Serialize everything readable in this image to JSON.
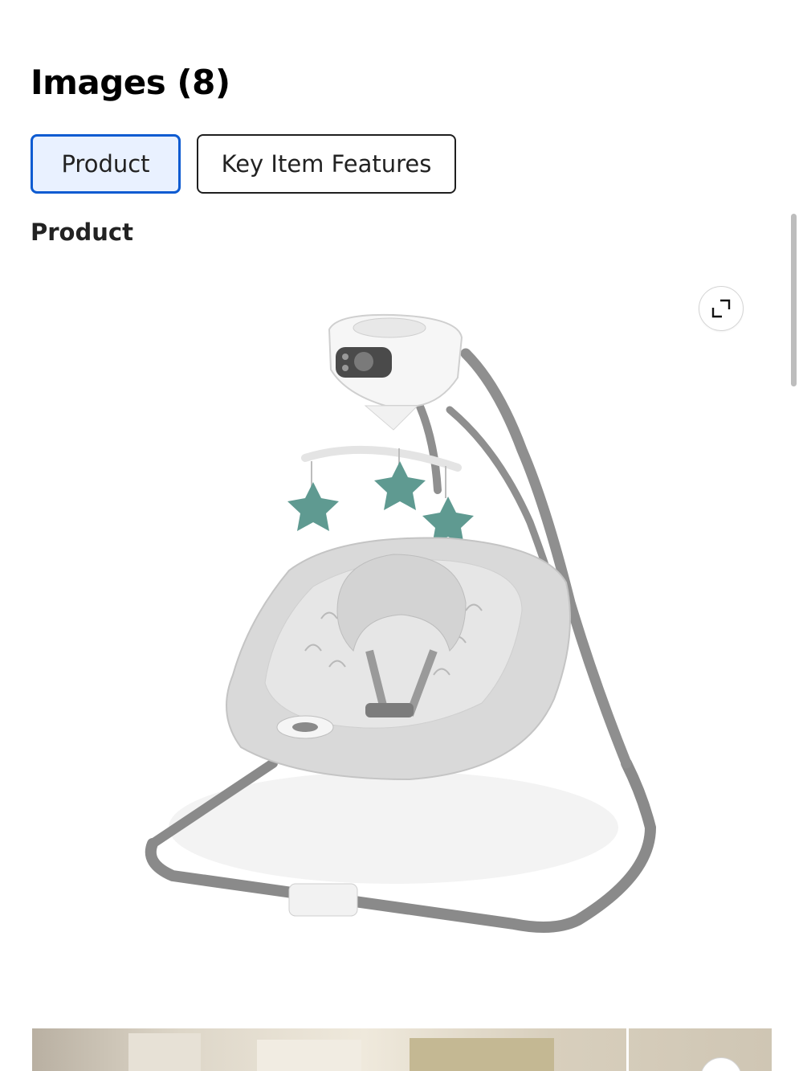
{
  "header": {
    "title": "Images (8)"
  },
  "tabs": [
    {
      "label": "Product",
      "active": true
    },
    {
      "label": "Key Item Features",
      "active": false
    }
  ],
  "section": {
    "heading": "Product"
  },
  "images": [
    {
      "alt": "expand-icon"
    }
  ],
  "colors": {
    "accent": "#0d5bd1",
    "active_tab_bg": "#e9f1ff",
    "star_green": "#5f9a91",
    "frame_gray": "#8c8c8c",
    "seat_gray": "#d9d9d9"
  },
  "icons": {
    "expand": "expand-icon"
  }
}
